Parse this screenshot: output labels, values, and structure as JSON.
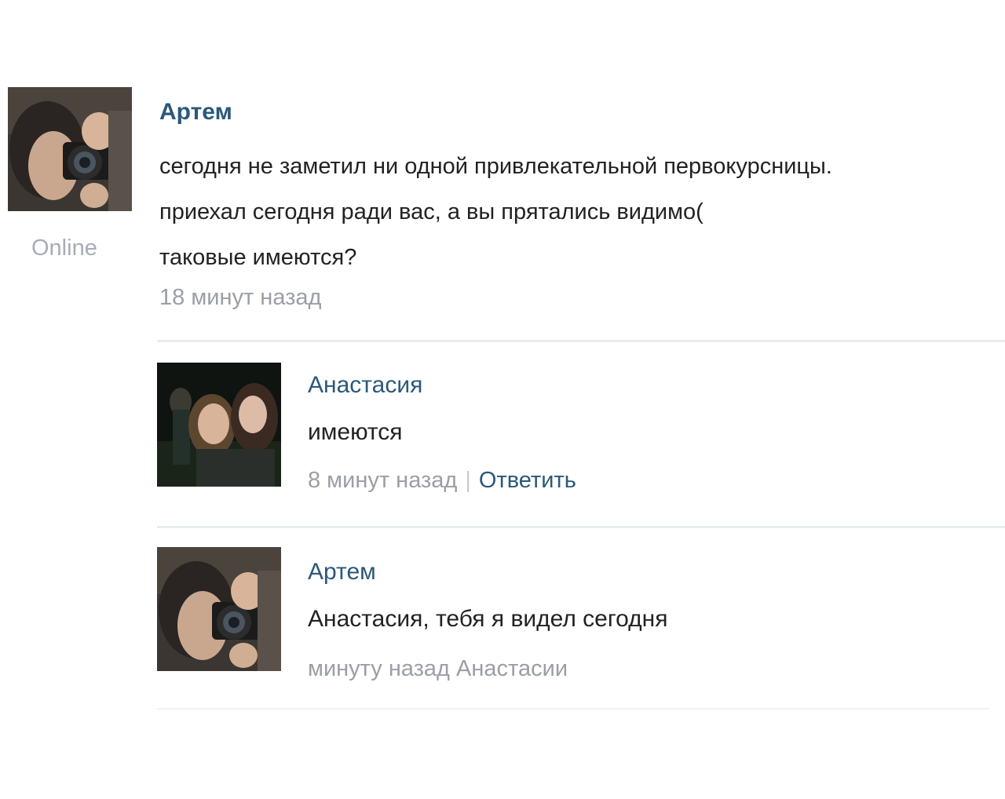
{
  "main_post": {
    "author": "Артем",
    "status": "Online",
    "lines": [
      "сегодня не заметил ни одной привлекательной первокурсницы.",
      "приехал сегодня ради вас, а вы прятались видимо(",
      "таковые имеются?"
    ],
    "time": "18 минут назад"
  },
  "replies": [
    {
      "author": "Анастасия",
      "text": "имеются",
      "time": "8 минут назад",
      "separator": "|",
      "action": "Ответить"
    },
    {
      "author": "Артем",
      "text": "Анастасия, тебя я видел сегодня",
      "time": "минуту назад",
      "reply_to": "Анастасии"
    }
  ],
  "colors": {
    "link": "#2b587a",
    "muted": "#9a9fa6",
    "text": "#222222",
    "divider": "#e8ecf0"
  }
}
